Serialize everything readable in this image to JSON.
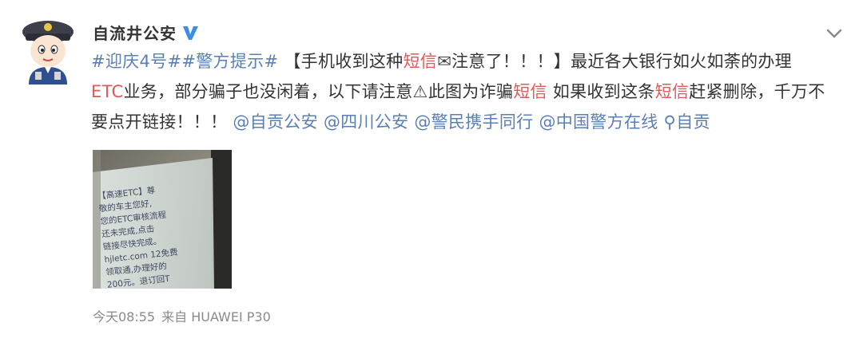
{
  "post": {
    "username": "自流井公安",
    "verified_icon": "verified-v-icon",
    "avatar_icon": "police-cartoon-avatar",
    "text": {
      "hashtag1": "#迎庆4号#",
      "hashtag2": "#警方提示#",
      "part1": "【手机收到这种",
      "kw1": "短信",
      "part2": "注意了！！！】最近各大银行如火如荼的办理",
      "kw_etc": "ETC",
      "part3": "业务，部分骗子也没闲着，以下请注意",
      "part4": "此图为诈骗",
      "kw2": "短信",
      "part5": " 如果收到这条",
      "kw3": "短信",
      "part6": "赶紧删除，千万不要点开链接！！！ ",
      "mention1": "@自贡公安",
      "mention2": "@四川公安",
      "mention3": "@警民携手同行",
      "mention4": "@中国警方在线",
      "location": "自贡"
    },
    "sms_image": {
      "lines": [
        "【高速ETC】尊",
        "敬的车主您好,",
        "您的ETC审核流程",
        "还未完成,点击",
        "链接尽快完成。",
        "hjletc.com 12免费",
        "领取通,办理好的",
        "200元。退订回T"
      ]
    },
    "time": "今天08:55",
    "source": "来自 HUAWEI P30",
    "colors": {
      "link": "#5a7fb5",
      "keyword": "#e05858",
      "text": "#333333",
      "meta": "#8a8a8a",
      "verified": "#3a8ee6"
    }
  }
}
